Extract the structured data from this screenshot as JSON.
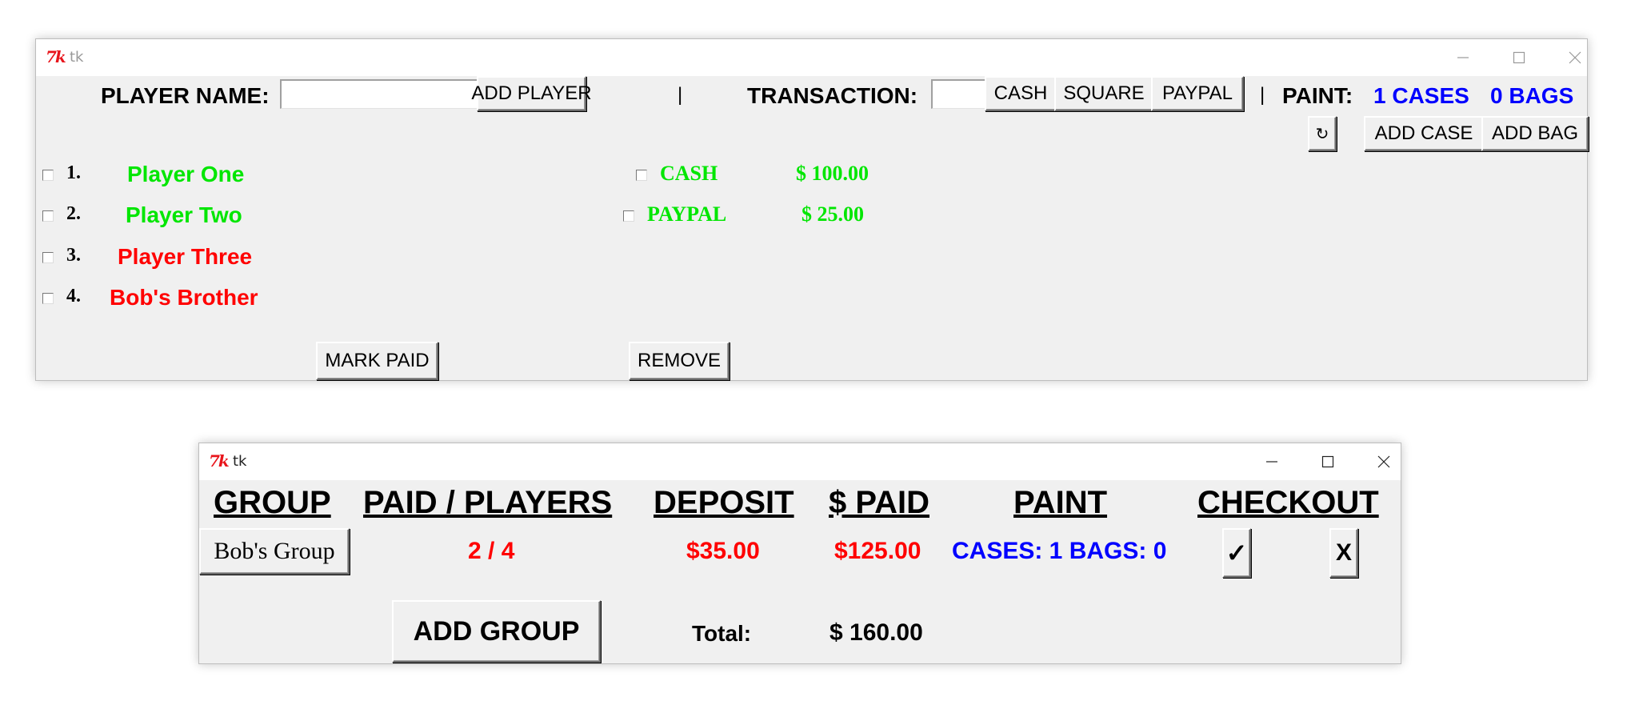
{
  "colors": {
    "paid_green": "#00e600",
    "unpaid_red": "#ff0000",
    "paint_blue": "#0000ff",
    "window_bg": "#f0f0f0",
    "logo_red": "#e8141b"
  },
  "window1": {
    "title": "tk",
    "player_name_label": "PLAYER NAME:",
    "player_name_value": "",
    "add_player_label": "ADD PLAYER",
    "separator": "|",
    "transaction_label": "TRANSACTION:",
    "transaction_value": "",
    "cash_label": "CASH",
    "square_label": "SQUARE",
    "paypal_label": "PAYPAL",
    "paint_label": "PAINT:",
    "cases_text": "1 CASES",
    "bags_text": "0 BAGS",
    "reset_icon": "↻",
    "add_case_label": "ADD CASE",
    "add_bag_label": "ADD BAG",
    "players": [
      {
        "number": "1.",
        "name": "Player One",
        "paid": true
      },
      {
        "number": "2.",
        "name": "Player Two",
        "paid": true
      },
      {
        "number": "3.",
        "name": "Player Three",
        "paid": false
      },
      {
        "number": "4.",
        "name": "Bob's Brother",
        "paid": false
      }
    ],
    "transactions": [
      {
        "method": "CASH",
        "amount": "$ 100.00"
      },
      {
        "method": "PAYPAL",
        "amount": "$ 25.00"
      }
    ],
    "mark_paid_label": "MARK PAID",
    "remove_label": "REMOVE"
  },
  "window2": {
    "title": "tk",
    "headers": {
      "group": "GROUP",
      "paid_players": "PAID / PLAYERS",
      "deposit": "DEPOSIT",
      "paid": "$ PAID",
      "paint": "PAINT",
      "checkout": "CHECKOUT"
    },
    "row": {
      "group_button": "Bob's Group",
      "paid_players": "2 / 4",
      "deposit": "$35.00",
      "paid": "$125.00",
      "paint": "CASES: 1 BAGS: 0",
      "check_label": "✓",
      "x_label": "X"
    },
    "add_group_label": "ADD GROUP",
    "total_label": "Total:",
    "total_value": "$ 160.00"
  }
}
